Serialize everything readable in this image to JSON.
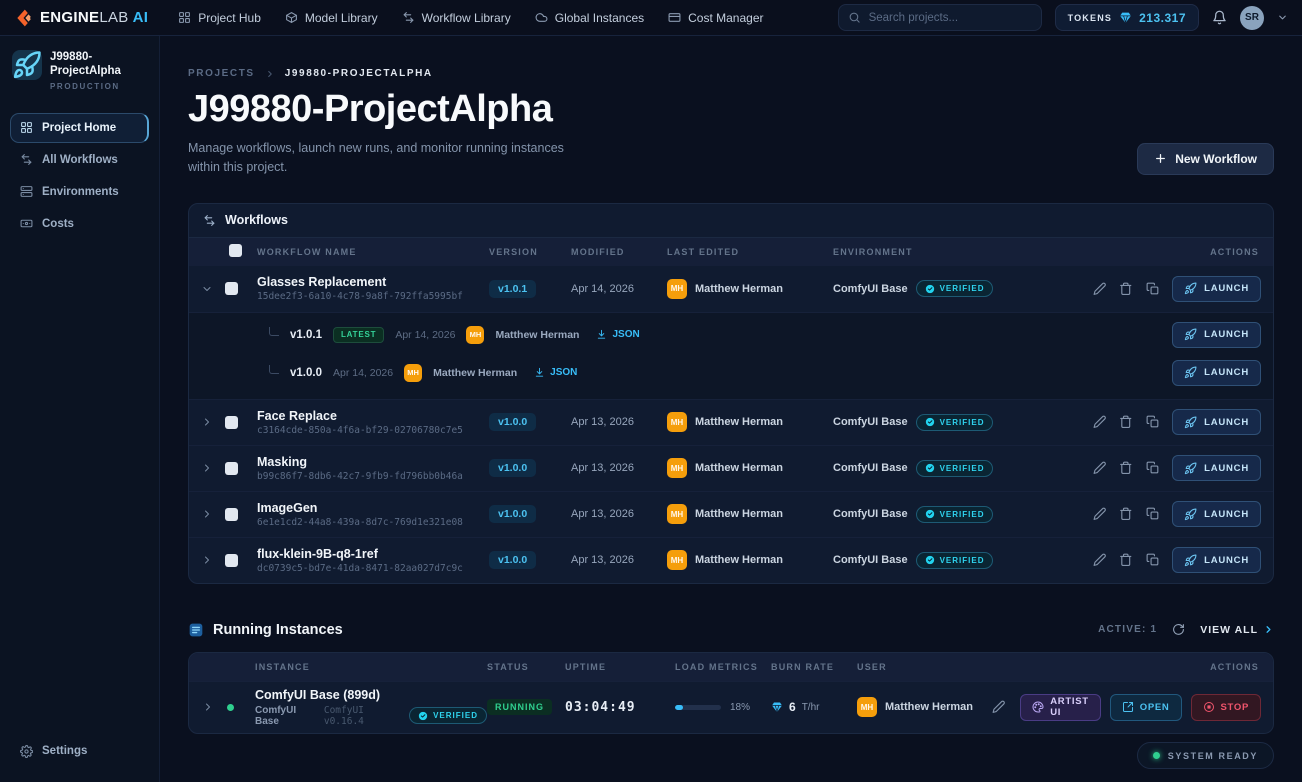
{
  "colors": {
    "accent": "#38bdf8",
    "verified": "#22d3ee",
    "success": "#34d399",
    "danger": "#f0546c",
    "avatar": "#f59e0b",
    "logo_orange": "#f4622a"
  },
  "topbar": {
    "logo": {
      "bold": "ENGINE",
      "light": "LAB",
      "accent": "AI",
      "icon": "engine-logo-icon"
    },
    "nav": [
      {
        "label": "Project Hub",
        "icon": "grid-icon"
      },
      {
        "label": "Model Library",
        "icon": "model-icon"
      },
      {
        "label": "Workflow Library",
        "icon": "workflow-icon"
      },
      {
        "label": "Global Instances",
        "icon": "cloud-icon"
      },
      {
        "label": "Cost Manager",
        "icon": "card-icon"
      }
    ],
    "search": {
      "placeholder": "Search projects...",
      "icon": "search-icon"
    },
    "tokens": {
      "label": "TOKENS",
      "value": "213.317",
      "icon": "gem-icon"
    },
    "bell": "bell-icon",
    "avatar": {
      "initials": "SR"
    }
  },
  "sidebar": {
    "project": {
      "name": "J99880-ProjectAlpha",
      "env": "PRODUCTION",
      "icon": "rocket-icon"
    },
    "items": [
      {
        "label": "Project Home",
        "icon": "grid-icon",
        "active": true
      },
      {
        "label": "All Workflows",
        "icon": "workflow-icon",
        "active": false
      },
      {
        "label": "Environments",
        "icon": "server-icon",
        "active": false
      },
      {
        "label": "Costs",
        "icon": "banknote-icon",
        "active": false
      }
    ],
    "settings": {
      "label": "Settings",
      "icon": "gear-icon"
    }
  },
  "page": {
    "breadcrumb": {
      "root": "PROJECTS",
      "current": "J99880-PROJECTALPHA"
    },
    "title": "J99880-ProjectAlpha",
    "subtitle": "Manage workflows, launch new runs, and monitor running instances within this project.",
    "new_workflow": "New Workflow"
  },
  "workflows": {
    "title": "Workflows",
    "columns": [
      "WORKFLOW NAME",
      "VERSION",
      "MODIFIED",
      "LAST EDITED",
      "ENVIRONMENT",
      "ACTIONS"
    ],
    "launch_label": "LAUNCH",
    "json_label": "JSON",
    "latest_label": "LATEST",
    "verified_label": "VERIFIED",
    "rows": [
      {
        "name": "Glasses Replacement",
        "uuid": "15dee2f3-6a10-4c78-9a8f-792ffa5995bf",
        "version": "v1.0.1",
        "modified": "Apr 14, 2026",
        "editor": "Matthew Herman",
        "editor_initials": "MH",
        "environment": "ComfyUI Base",
        "verified": true,
        "expanded": true,
        "versions": [
          {
            "version": "v1.0.1",
            "latest": true,
            "date": "Apr 14, 2026",
            "editor": "Matthew Herman",
            "editor_initials": "MH"
          },
          {
            "version": "v1.0.0",
            "latest": false,
            "date": "Apr 14, 2026",
            "editor": "Matthew Herman",
            "editor_initials": "MH"
          }
        ]
      },
      {
        "name": "Face Replace",
        "uuid": "c3164cde-850a-4f6a-bf29-02706780c7e5",
        "version": "v1.0.0",
        "modified": "Apr 13, 2026",
        "editor": "Matthew Herman",
        "editor_initials": "MH",
        "environment": "ComfyUI Base",
        "verified": true,
        "expanded": false,
        "versions": []
      },
      {
        "name": "Masking",
        "uuid": "b99c86f7-8db6-42c7-9fb9-fd796bb0b46a",
        "version": "v1.0.0",
        "modified": "Apr 13, 2026",
        "editor": "Matthew Herman",
        "editor_initials": "MH",
        "environment": "ComfyUI Base",
        "verified": true,
        "expanded": false,
        "versions": []
      },
      {
        "name": "ImageGen",
        "uuid": "6e1e1cd2-44a8-439a-8d7c-769d1e321e08",
        "version": "v1.0.0",
        "modified": "Apr 13, 2026",
        "editor": "Matthew Herman",
        "editor_initials": "MH",
        "environment": "ComfyUI Base",
        "verified": true,
        "expanded": false,
        "versions": []
      },
      {
        "name": "flux-klein-9B-q8-1ref",
        "uuid": "dc0739c5-bd7e-41da-8471-82aa027d7c9c",
        "version": "v1.0.0",
        "modified": "Apr 13, 2026",
        "editor": "Matthew Herman",
        "editor_initials": "MH",
        "environment": "ComfyUI Base",
        "verified": true,
        "expanded": false,
        "versions": []
      }
    ]
  },
  "instances": {
    "title": "Running Instances",
    "icon": "running-instances-icon",
    "active_label": "ACTIVE: 1",
    "view_all": "VIEW ALL",
    "columns": [
      "INSTANCE",
      "STATUS",
      "UPTIME",
      "LOAD METRICS",
      "BURN RATE",
      "USER",
      "ACTIONS"
    ],
    "verified_label": "VERIFIED",
    "rows": [
      {
        "name": "ComfyUI Base (899d)",
        "env": "ComfyUI Base",
        "runtime": "ComfyUI v0.16.4",
        "verified": true,
        "status": "RUNNING",
        "uptime": "03:04:49",
        "load_pct": 18,
        "load_label": "18%",
        "burn_value": "6",
        "burn_unit": "T/hr",
        "user": "Matthew Herman",
        "user_initials": "MH",
        "actions": {
          "artist": "ARTIST UI",
          "open": "OPEN",
          "stop": "STOP"
        }
      }
    ]
  },
  "footer": {
    "system_ready": "SYSTEM READY"
  }
}
